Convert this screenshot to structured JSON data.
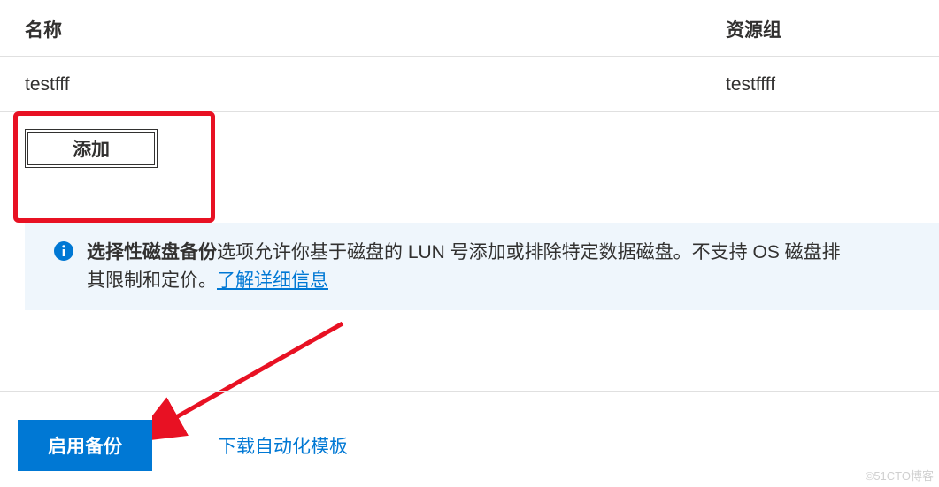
{
  "table": {
    "header": {
      "name": "名称",
      "group": "资源组"
    },
    "rows": [
      {
        "name": "testfff",
        "group": "testffff"
      }
    ]
  },
  "add_button_label": "添加",
  "info": {
    "bold_prefix": "选择性磁盘备份",
    "text_part1": "选项允许你基于磁盘的 LUN 号添加或排除特定数据磁盘。不支持 OS 磁盘排",
    "text_part2": "其限制和定价。",
    "link_label": "了解详细信息"
  },
  "footer": {
    "enable_backup": "启用备份",
    "download_template": "下载自动化模板"
  },
  "watermark": "©51CTO博客",
  "colors": {
    "primary": "#0078d4",
    "danger": "#e81123"
  }
}
